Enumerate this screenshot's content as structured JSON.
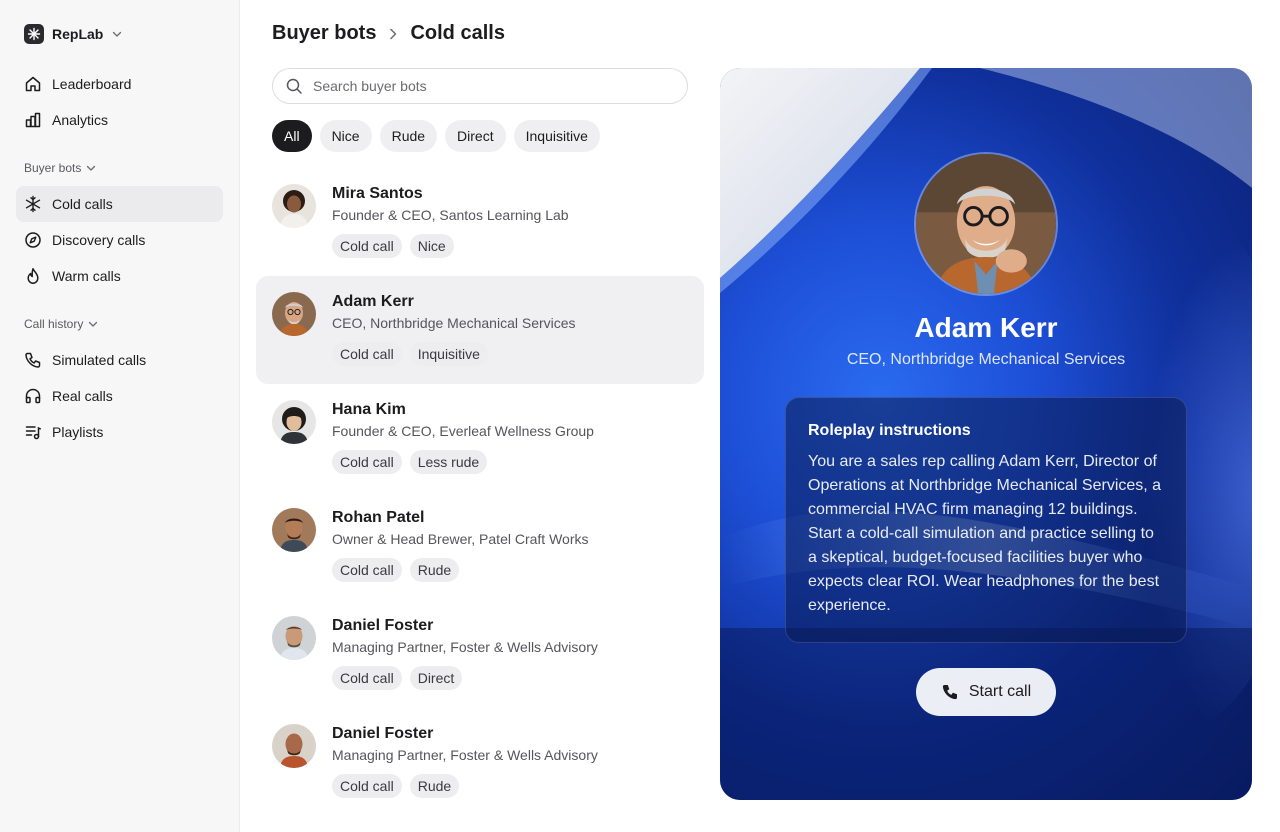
{
  "workspace": {
    "name": "RepLab"
  },
  "nav": {
    "top": [
      {
        "label": "Leaderboard",
        "icon": "home-icon"
      },
      {
        "label": "Analytics",
        "icon": "bar-chart-icon"
      }
    ],
    "buyer_bots_section": "Buyer bots",
    "buyer_bots": [
      {
        "label": "Cold calls",
        "icon": "snowflake-icon",
        "active": true
      },
      {
        "label": "Discovery calls",
        "icon": "compass-icon"
      },
      {
        "label": "Warm calls",
        "icon": "flame-icon"
      }
    ],
    "call_history_section": "Call history",
    "call_history": [
      {
        "label": "Simulated calls",
        "icon": "phone-icon"
      },
      {
        "label": "Real calls",
        "icon": "headphones-icon"
      },
      {
        "label": "Playlists",
        "icon": "playlist-icon"
      }
    ]
  },
  "breadcrumb": {
    "parent": "Buyer bots",
    "current": "Cold calls"
  },
  "search": {
    "placeholder": "Search buyer bots"
  },
  "filters": [
    "All",
    "Nice",
    "Rude",
    "Direct",
    "Inquisitive"
  ],
  "bots": [
    {
      "name": "Mira Santos",
      "title": "Founder & CEO, Santos Learning Lab",
      "tags": [
        "Cold call",
        "Nice"
      ]
    },
    {
      "name": "Adam Kerr",
      "title": "CEO, Northbridge Mechanical Services",
      "tags": [
        "Cold call",
        "Inquisitive"
      ]
    },
    {
      "name": "Hana Kim",
      "title": "Founder & CEO, Everleaf Wellness Group",
      "tags": [
        "Cold call",
        "Less rude"
      ]
    },
    {
      "name": "Rohan Patel",
      "title": "Owner & Head Brewer, Patel Craft Works",
      "tags": [
        "Cold call",
        "Rude"
      ]
    },
    {
      "name": "Daniel Foster",
      "title": "Managing Partner, Foster & Wells Advisory",
      "tags": [
        "Cold call",
        "Direct"
      ]
    },
    {
      "name": "Daniel Foster",
      "title": "Managing Partner, Foster & Wells Advisory",
      "tags": [
        "Cold call",
        "Rude"
      ]
    }
  ],
  "detail": {
    "name": "Adam Kerr",
    "title": "CEO, Northbridge Mechanical Services",
    "instructions_heading": "Roleplay instructions",
    "instructions_body": "You are a sales rep calling Adam Kerr, Director of Operations at Northbridge Mechanical Services, a commercial HVAC firm managing 12 buildings. Start a cold-call simulation and practice selling to a skeptical, budget-focused facilities buyer who expects clear ROI. Wear headphones for the best experience.",
    "start_call_label": "Start call"
  }
}
